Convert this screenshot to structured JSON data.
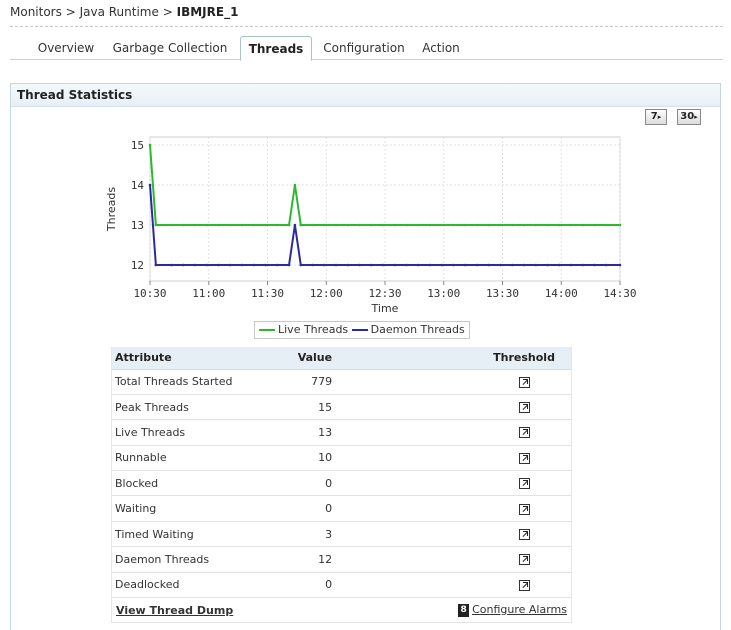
{
  "breadcrumb": {
    "items": [
      "Monitors",
      "Java Runtime"
    ],
    "separator": ">",
    "current": "IBMJRE_1"
  },
  "tabs": [
    {
      "label": "Overview",
      "active": false
    },
    {
      "label": "Garbage Collection",
      "active": false
    },
    {
      "label": "Threads",
      "active": true
    },
    {
      "label": "Configuration",
      "active": false
    },
    {
      "label": "Action",
      "active": false
    }
  ],
  "panel": {
    "title": "Thread Statistics",
    "period_buttons": [
      "7",
      "30"
    ]
  },
  "chart_data": {
    "type": "line",
    "xlabel": "Time",
    "ylabel": "Threads",
    "x_ticks": [
      "10:30",
      "11:00",
      "11:30",
      "12:00",
      "12:30",
      "13:00",
      "13:30",
      "14:00",
      "14:30"
    ],
    "y_ticks": [
      12,
      13,
      14,
      15
    ],
    "ylim": [
      11.6,
      15.2
    ],
    "grid": true,
    "legend_position": "bottom",
    "x_minutes_from_10_30": [
      0,
      3,
      11,
      17,
      23,
      29,
      35,
      41,
      47,
      53,
      59,
      65,
      71,
      74,
      77,
      83,
      89,
      95,
      101,
      107,
      113,
      119,
      125,
      131,
      137,
      143,
      149,
      155,
      161,
      167,
      173,
      179,
      185,
      191,
      197,
      203,
      209,
      215,
      221,
      227,
      233,
      240
    ],
    "series": [
      {
        "name": "Live Threads",
        "color": "#2eb82e",
        "values": [
          15,
          13,
          13,
          13,
          13,
          13,
          13,
          13,
          13,
          13,
          13,
          13,
          13,
          14,
          13,
          13,
          13,
          13,
          13,
          13,
          13,
          13,
          13,
          13,
          13,
          13,
          13,
          13,
          13,
          13,
          13,
          13,
          13,
          13,
          13,
          13,
          13,
          13,
          13,
          13,
          13,
          13
        ]
      },
      {
        "name": "Daemon Threads",
        "color": "#2b2b9e",
        "values": [
          14,
          12,
          12,
          12,
          12,
          12,
          12,
          12,
          12,
          12,
          12,
          12,
          12,
          13,
          12,
          12,
          12,
          12,
          12,
          12,
          12,
          12,
          12,
          12,
          12,
          12,
          12,
          12,
          12,
          12,
          12,
          12,
          12,
          12,
          12,
          12,
          12,
          12,
          12,
          12,
          12,
          12
        ]
      }
    ]
  },
  "table": {
    "headers": {
      "attribute": "Attribute",
      "value": "Value",
      "threshold": "Threshold"
    },
    "rows": [
      {
        "attribute": "Total Threads Started",
        "value": "779"
      },
      {
        "attribute": "Peak Threads",
        "value": "15"
      },
      {
        "attribute": "Live Threads",
        "value": "13"
      },
      {
        "attribute": "Runnable",
        "value": "10"
      },
      {
        "attribute": "Blocked",
        "value": "0"
      },
      {
        "attribute": "Waiting",
        "value": "0"
      },
      {
        "attribute": "Timed Waiting",
        "value": "3"
      },
      {
        "attribute": "Daemon Threads",
        "value": "12"
      },
      {
        "attribute": "Deadlocked",
        "value": "0"
      }
    ]
  },
  "footer": {
    "dump_link": "View Thread Dump",
    "alarm_icon_glyph": "8",
    "alarm_link": "Configure Alarms"
  }
}
